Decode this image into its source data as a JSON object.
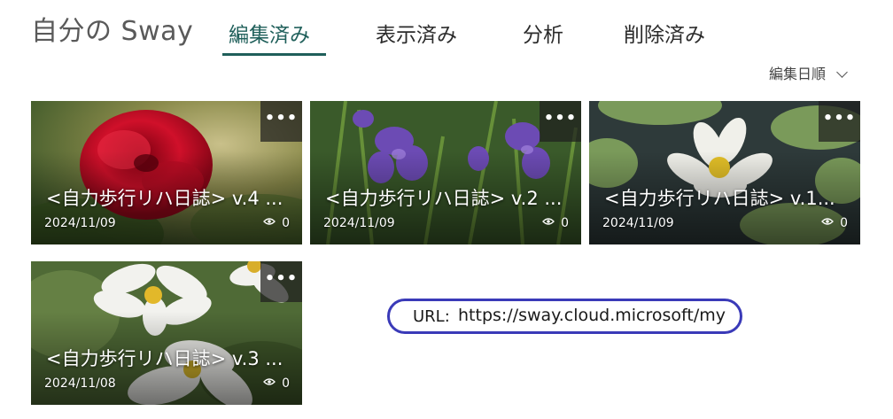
{
  "header": {
    "app_title": "自分の Sway",
    "tabs": [
      {
        "label": "編集済み",
        "active": true
      },
      {
        "label": "表示済み",
        "active": false
      },
      {
        "label": "分析",
        "active": false
      },
      {
        "label": "削除済み",
        "active": false
      }
    ],
    "sort_label": "編集日順"
  },
  "colors": {
    "accent": "#1f5f5a",
    "annotation_border": "#3a3ab8"
  },
  "cards": [
    {
      "title": "<自力歩行リハ日誌> v.4 ...",
      "date": "2024/11/09",
      "views": "0",
      "image": "red-carnation-photo"
    },
    {
      "title": "<自力歩行リハ日誌> v.2 ...",
      "date": "2024/11/09",
      "views": "0",
      "image": "purple-violets-photo"
    },
    {
      "title": "<自力歩行リハ日誌> v.1...",
      "date": "2024/11/09",
      "views": "0",
      "image": "white-water-lily-photo"
    },
    {
      "title": "<自力歩行リハ日誌> v.3 ...",
      "date": "2024/11/08",
      "views": "0",
      "image": "white-cosmos-photo"
    }
  ],
  "more_label": "•••",
  "annotation": {
    "label": "URL:",
    "value": "https://sway.cloud.microsoft/my"
  }
}
